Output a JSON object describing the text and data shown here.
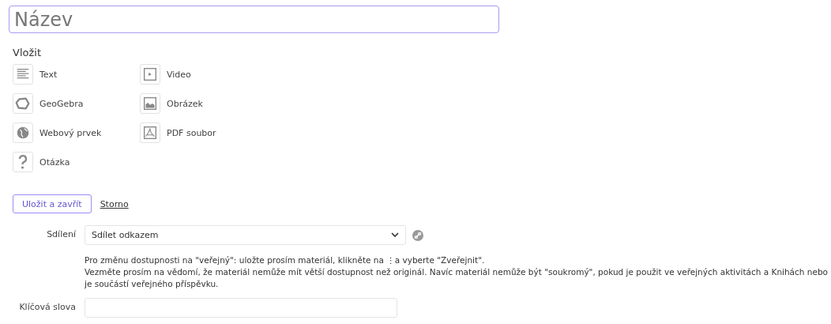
{
  "title_field": {
    "placeholder": "Název"
  },
  "insert": {
    "heading": "Vložit",
    "items": [
      {
        "kind": "text",
        "label": "Text"
      },
      {
        "kind": "video",
        "label": "Video"
      },
      {
        "kind": "geogebra",
        "label": "GeoGebra"
      },
      {
        "kind": "image",
        "label": "Obrázek"
      },
      {
        "kind": "web",
        "label": "Webový prvek"
      },
      {
        "kind": "pdf",
        "label": "PDF soubor"
      },
      {
        "kind": "question",
        "label": "Otázka"
      }
    ]
  },
  "actions": {
    "save": "Uložit a zavřít",
    "cancel": "Storno"
  },
  "sharing": {
    "label": "Sdílení",
    "value": "Sdílet odkazem",
    "info_lines": [
      "Pro změnu dostupnosti na \"veřejný\": uložte prosím materiál, klikněte na ⋮a vyberte \"Zveřejnit\".",
      "Vezměte prosím na vědomí, že materiál nemůže mít větší dostupnost než originál. Navíc materiál nemůže být \"soukromý\", pokud je použit ve veřejných aktivitách a Knihách nebo je součástí veřejného příspěvku."
    ]
  },
  "keywords": {
    "label": "Klíčová slova"
  }
}
